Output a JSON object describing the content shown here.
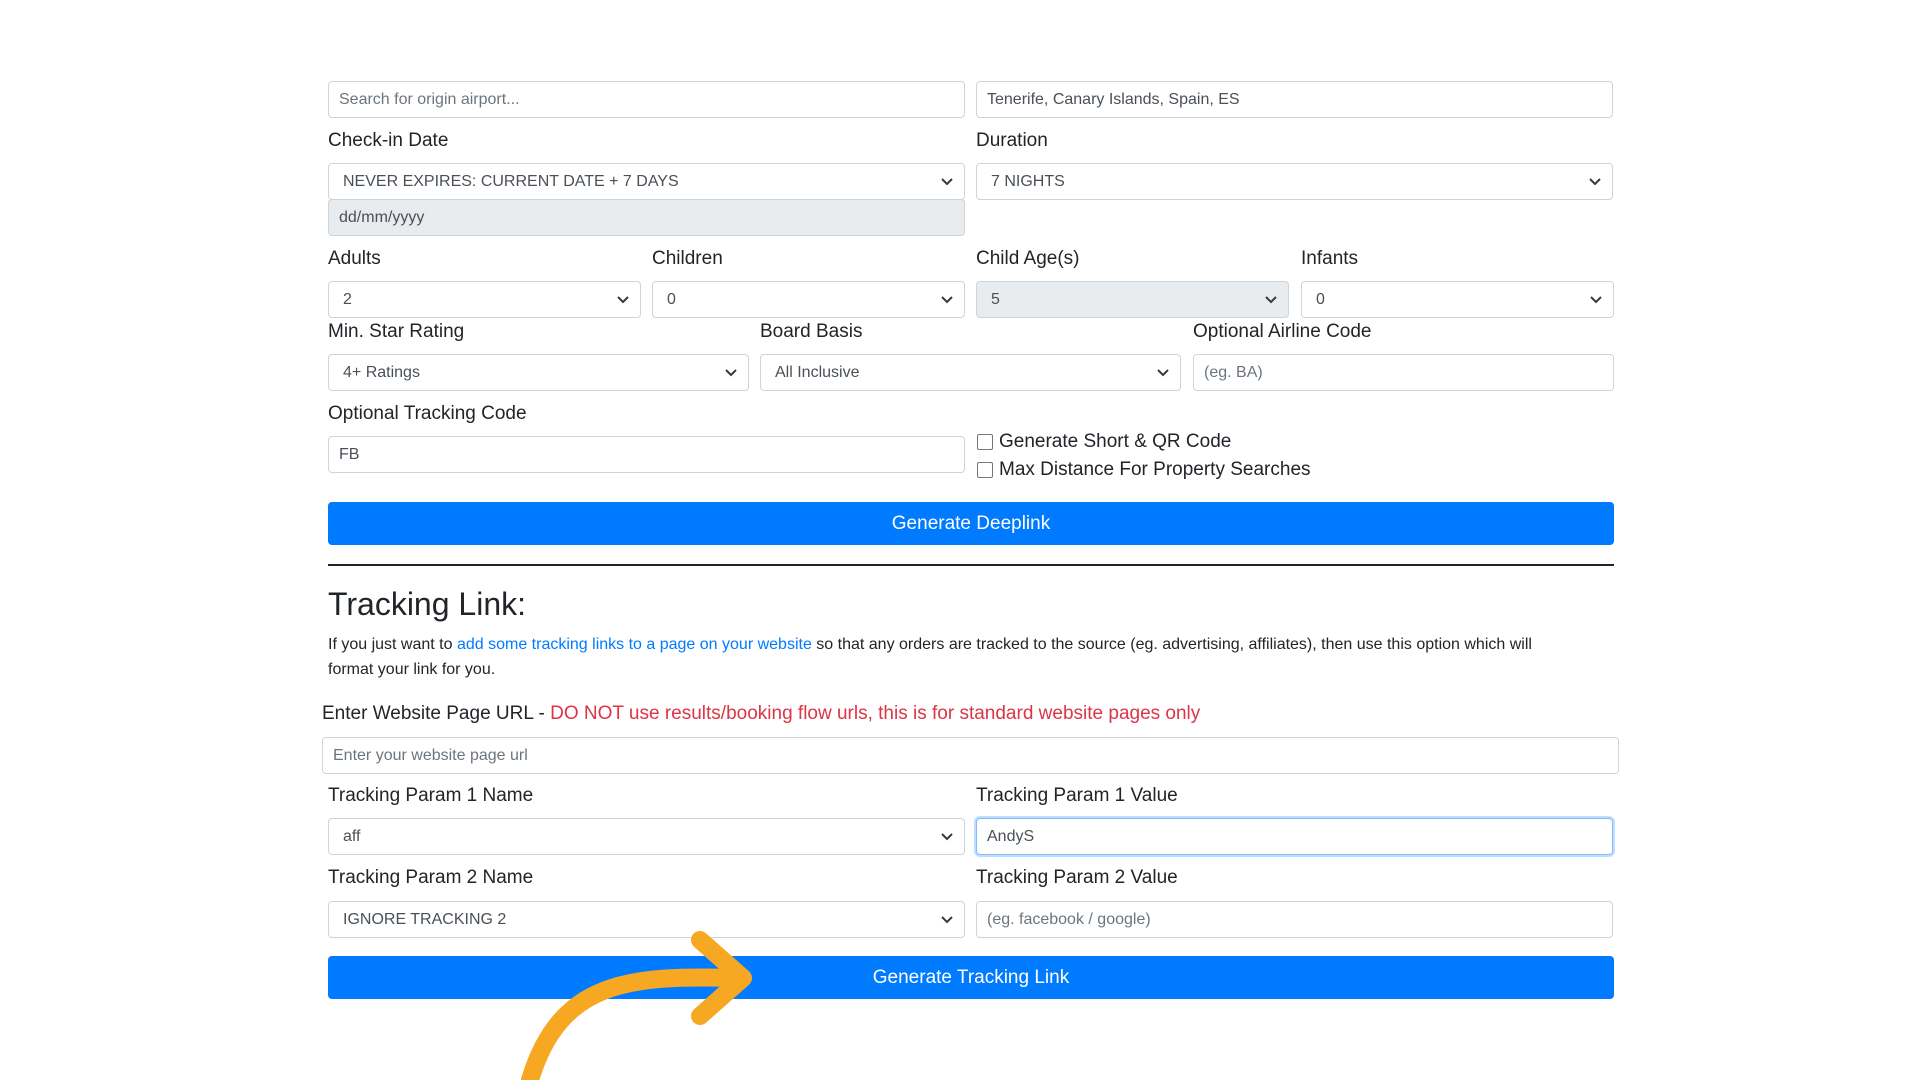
{
  "origin": {
    "placeholder": "Search for origin airport..."
  },
  "destination": {
    "value": "Tenerife, Canary Islands, Spain, ES"
  },
  "checkin": {
    "label": "Check-in Date",
    "selected": "NEVER EXPIRES: CURRENT DATE + 7 DAYS",
    "date_placeholder": "dd/mm/yyyy"
  },
  "duration": {
    "label": "Duration",
    "selected": "7 NIGHTS"
  },
  "adults": {
    "label": "Adults",
    "selected": "2"
  },
  "children": {
    "label": "Children",
    "selected": "0"
  },
  "child_ages": {
    "label": "Child Age(s)",
    "selected": "5"
  },
  "infants": {
    "label": "Infants",
    "selected": "0"
  },
  "star_rating": {
    "label": "Min. Star Rating",
    "selected": "4+ Ratings"
  },
  "board_basis": {
    "label": "Board Basis",
    "selected": "All Inclusive"
  },
  "airline_code": {
    "label": "Optional Airline Code",
    "placeholder": "(eg. BA)"
  },
  "tracking_code": {
    "label": "Optional Tracking Code",
    "value": "FB"
  },
  "options": {
    "short_qr_label": "Generate Short & QR Code",
    "max_distance_label": "Max Distance For Property Searches"
  },
  "deeplink_button": "Generate Deeplink",
  "tracking_section": {
    "title": "Tracking Link:",
    "desc_prefix": "If you just want to",
    "desc_link": "add some tracking links to a page on your website",
    "desc_line1_suffix": "so that any orders are tracked to the source (eg. advertising, affiliates), then use this option which will",
    "desc_line2": "format your link for you.",
    "url_label": "Enter Website Page URL -",
    "url_warning": "DO NOT use results/booking flow urls, this is for standard website pages only",
    "url_placeholder": "Enter your website page url",
    "param1_name_label": "Tracking Param 1 Name",
    "param1_name_selected": "aff",
    "param1_value_label": "Tracking Param 1 Value",
    "param1_value": "AndyS",
    "param2_name_label": "Tracking Param 2 Name",
    "param2_name_selected": "IGNORE TRACKING 2",
    "param2_value_label": "Tracking Param 2 Value",
    "param2_value_placeholder": "(eg. facebook / google)",
    "button": "Generate Tracking Link"
  },
  "colors": {
    "primary": "#007bff",
    "danger": "#dc3545",
    "annotation_arrow": "#F7A823"
  },
  "icons": {
    "select_chevron": "chevron-down-icon",
    "annotation": "curved-arrow-icon"
  }
}
